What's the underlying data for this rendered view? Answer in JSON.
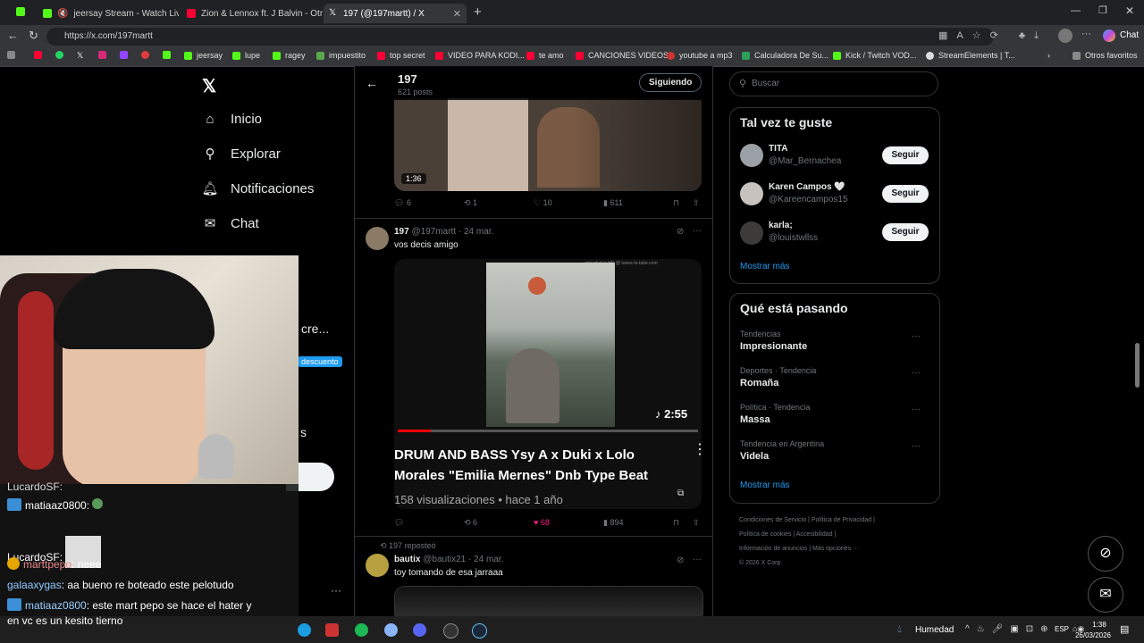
{
  "browser": {
    "tabs": [
      {
        "title": "jeersay Stream - Watch Live o",
        "color": "#53fc18"
      },
      {
        "title": "Zion & Lennox ft. J Balvin - Otra V",
        "color": "#ff0033"
      },
      {
        "title": "197 (@197martt) / X",
        "color": "#ffffff"
      }
    ],
    "url": "https://x.com/197martt",
    "bookmarks": [
      "jeersay",
      "lupe",
      "ragey",
      "impuestito",
      "top secret",
      "VIDEO PARA KODI...",
      "te amo",
      "CANCIONES VIDEOS",
      "youtube a mp3",
      "Calculadora De Su...",
      "Kick / Twitch VOD...",
      "StreamElements | T..."
    ],
    "bookmarks_other": "Otros favoritos",
    "copilot": "Chat"
  },
  "nav": {
    "home": "Inicio",
    "explore": "Explorar",
    "notifications": "Notificaciones",
    "chat": "Chat",
    "partial_cre": "cre...",
    "partial_s": "s",
    "discount": "descuento"
  },
  "profile_header": {
    "name": "197",
    "posts": "621 posts",
    "following_label": "Siguiendo"
  },
  "post1": {
    "duration": "1:36",
    "replies": "6",
    "reposts": "1",
    "likes": "10",
    "views": "611"
  },
  "post2": {
    "name": "197",
    "handle": "@197martt",
    "date": "· 24 mar.",
    "text": "vos decis amigo",
    "video_title": "DRUM AND BASS Ysy A x Duki x Lolo Morales \"Emilia Mernes\" Dnb Type Beat",
    "video_meta": "158 visualizaciones • hace 1 año",
    "video_duration": "2:55",
    "watermark": "uploaded in HD @ tunes-to-tube.com",
    "replies": "",
    "reposts": "6",
    "likes": "68",
    "views": "894"
  },
  "post3": {
    "reposted_by": "197 reposteó",
    "name": "bautix",
    "handle": "@bautix21",
    "date": "· 24 mar.",
    "text": "toy tomando de esa jarraaa"
  },
  "search": {
    "placeholder": "Buscar"
  },
  "suggest": {
    "title": "Tal vez te guste",
    "users": [
      {
        "name": "TITA",
        "handle": "@Mar_Bernachea",
        "button": "Seguir"
      },
      {
        "name": "Karen Campos 🤍",
        "handle": "@Kareencampos15",
        "button": "Seguir"
      },
      {
        "name": "karla;",
        "handle": "@louistwllss",
        "button": "Seguir"
      }
    ],
    "more": "Mostrar más"
  },
  "trends": {
    "title": "Qué está pasando",
    "items": [
      {
        "category": "Tendencias",
        "name": "Impresionante"
      },
      {
        "category": "Deportes · Tendencia",
        "name": "Romaña"
      },
      {
        "category": "Política · Tendencia",
        "name": "Massa"
      },
      {
        "category": "Tendencia en Argentina",
        "name": "Videla"
      }
    ],
    "more": "Mostrar más"
  },
  "footer": {
    "links": [
      "Condiciones de Servicio",
      "Política de Privacidad",
      "Política de cookies",
      "Accesibilidad",
      "Información de anuncios",
      "Más opciones ···"
    ],
    "copyright": "© 2026 X Corp."
  },
  "chat": {
    "lines": [
      {
        "user": "LucardoSF:",
        "msg": ""
      },
      {
        "user": "matiaaz0800:",
        "msg": ""
      },
      {
        "user": "LucardoSF:",
        "msg": ""
      },
      {
        "user": "marttpepo",
        "msg": ": neee"
      },
      {
        "user": "galaaxygas",
        "msg": ": aa bueno re boteado este pelotudo"
      },
      {
        "user": "",
        "msg": ": este mart pepo se hace el hater y"
      },
      {
        "user": "",
        "msg": "en vc es un kesito tierno"
      }
    ],
    "line6_user": "matiaaz0800",
    "line7_user": "matiaaz0800"
  },
  "taskbar": {
    "weather": "Humedad",
    "lang": "ESP",
    "time": "1:38",
    "date": "26/03/2026"
  }
}
